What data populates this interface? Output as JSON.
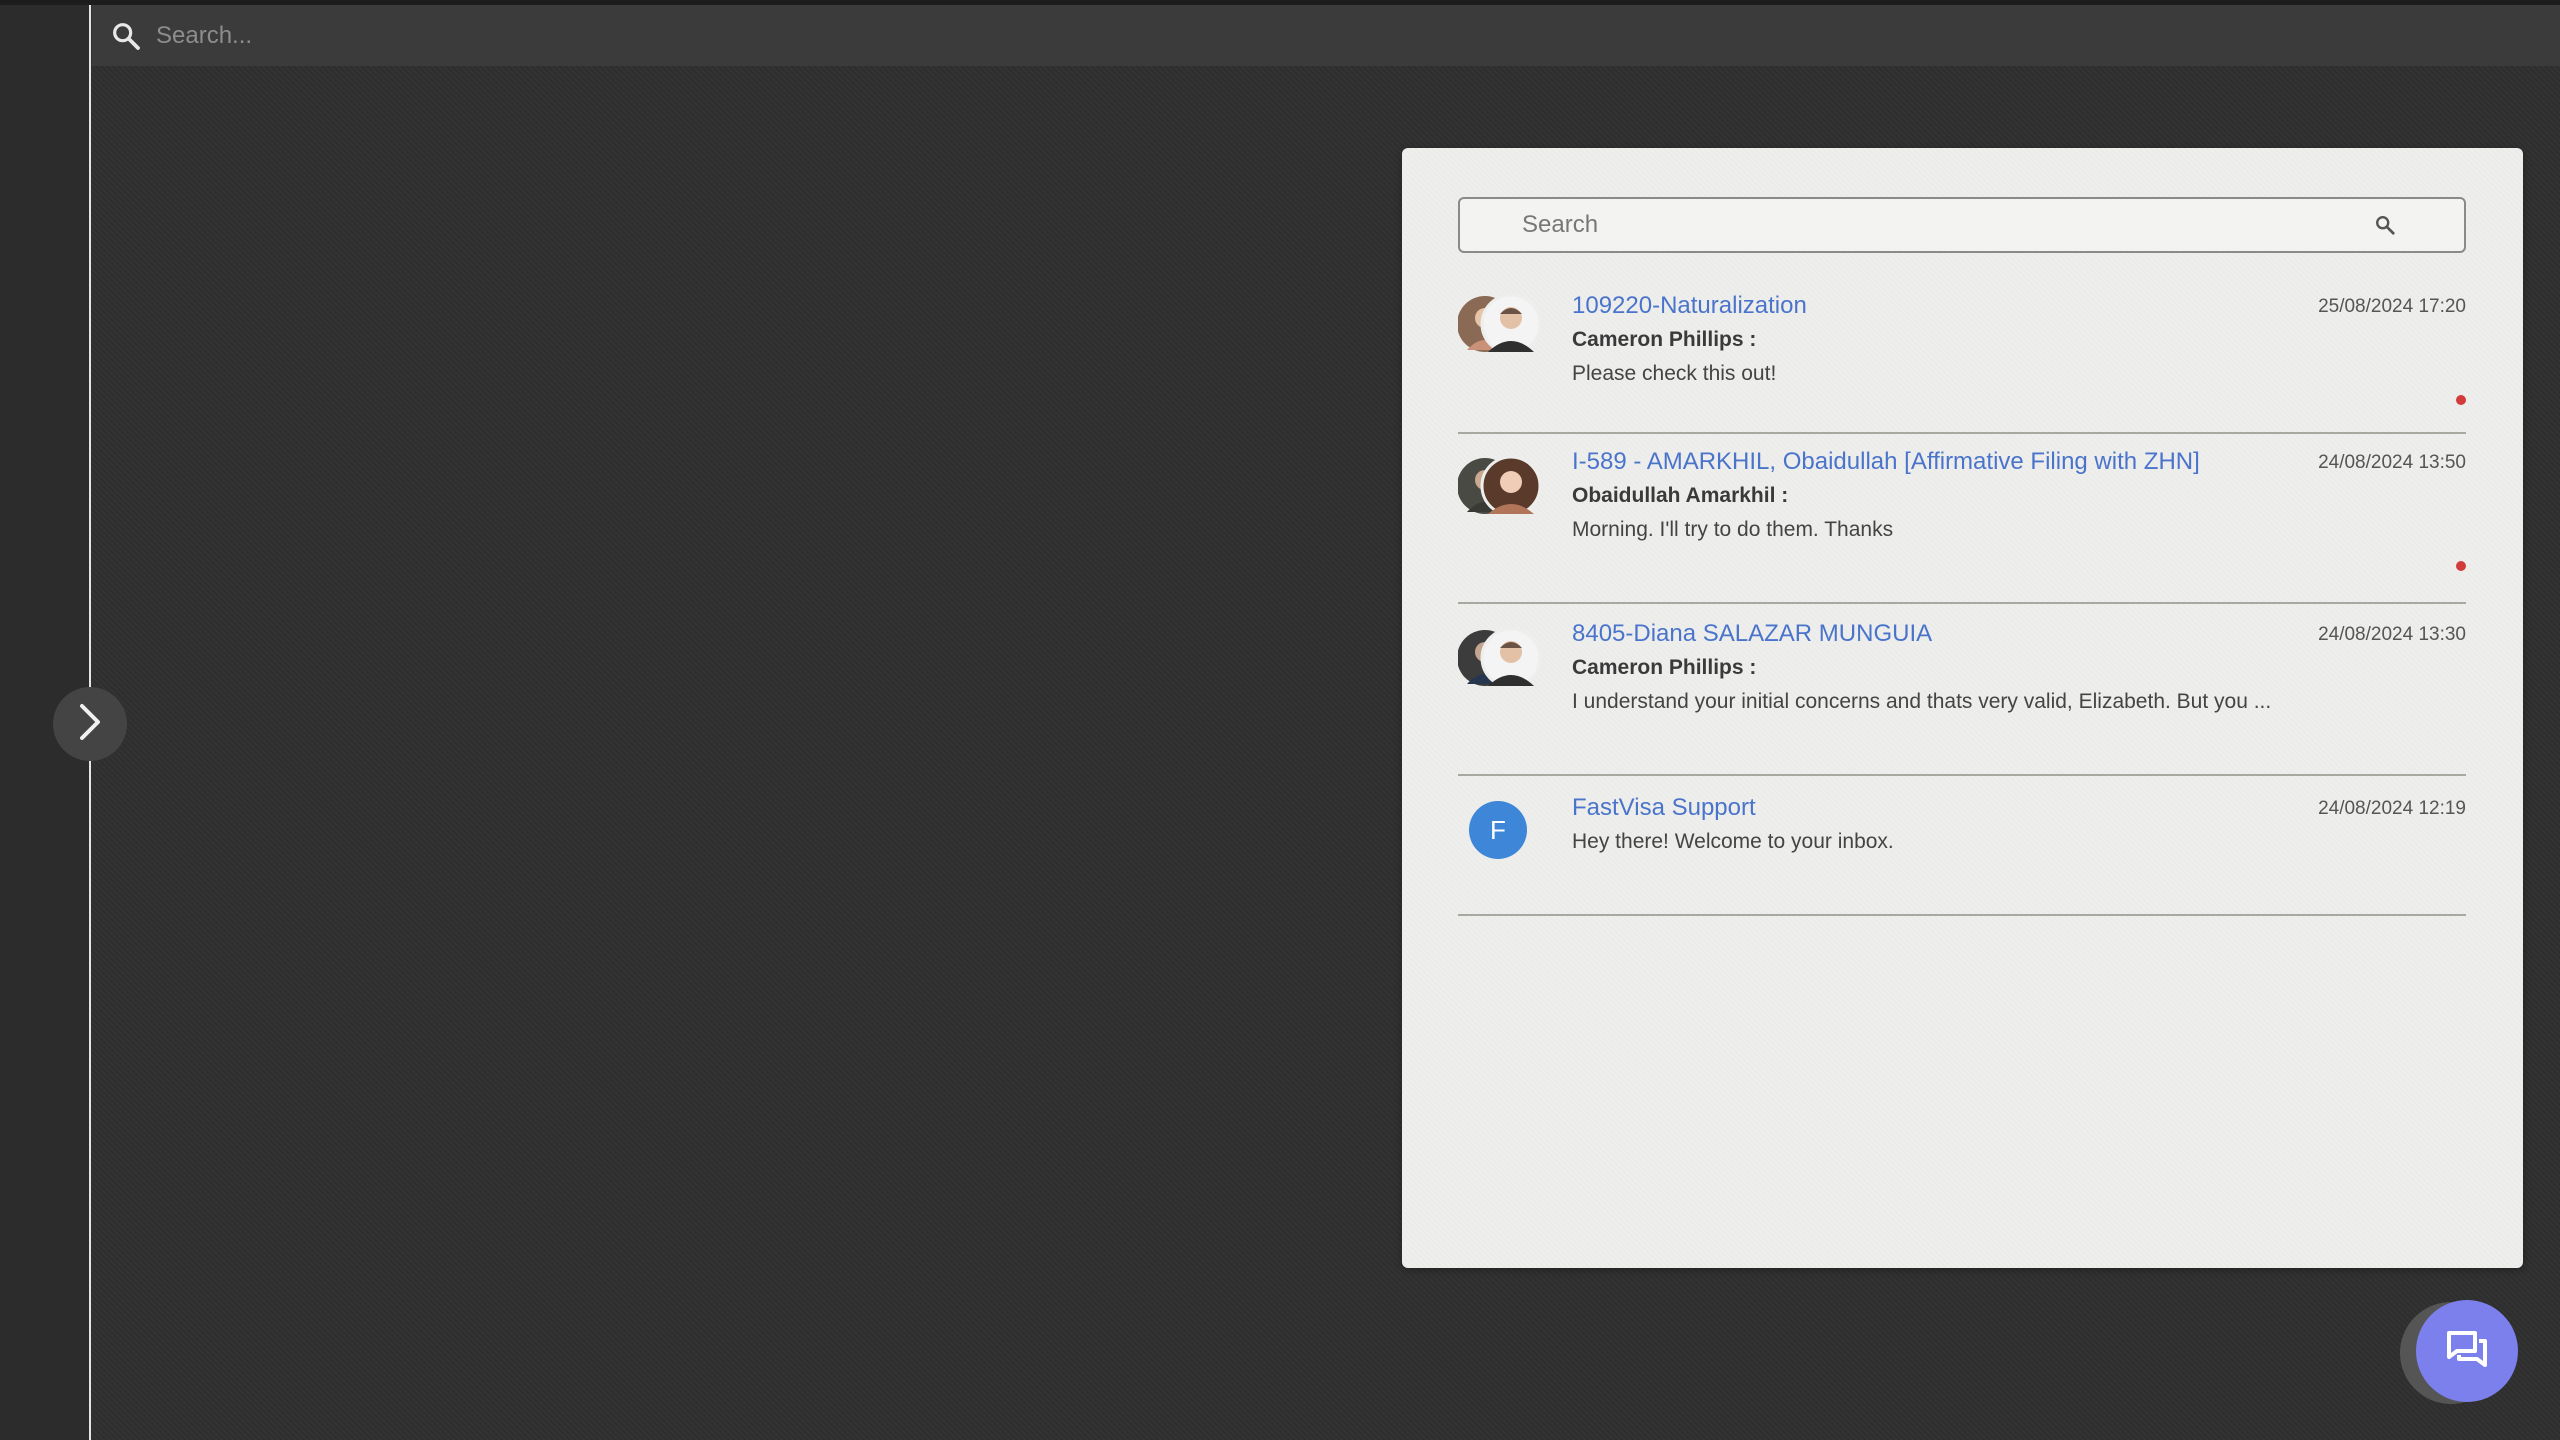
{
  "top_search": {
    "placeholder": "Search..."
  },
  "panel": {
    "search": {
      "placeholder": "Search"
    },
    "conversations": [
      {
        "title": "109220-Naturalization",
        "time": "25/08/2024 17:20",
        "sender": "Cameron Phillips :",
        "message": "Please check this out!",
        "unread": true
      },
      {
        "title": "I-589 - AMARKHIL, Obaidullah [Affirmative Filing with ZHN]",
        "time": "24/08/2024 13:50",
        "sender": "Obaidullah Amarkhil :",
        "message": "Morning. I'll try to do them. Thanks",
        "unread": true
      },
      {
        "title": "8405-Diana SALAZAR MUNGUIA",
        "time": "24/08/2024 13:30",
        "sender": "Cameron Phillips :",
        "message": "I understand your initial concerns and thats very valid, Elizabeth. But you ...",
        "unread": false
      },
      {
        "title": "FastVisa Support",
        "time": "24/08/2024 12:19",
        "avatar_letter": "F",
        "message": "Hey there! Welcome to your inbox.",
        "unread": false
      }
    ]
  },
  "colors": {
    "accent": "#4a74cc",
    "unread_dot": "#d13b3b",
    "fab": "#7b80ec",
    "avatar_f": "#3d86d8"
  }
}
